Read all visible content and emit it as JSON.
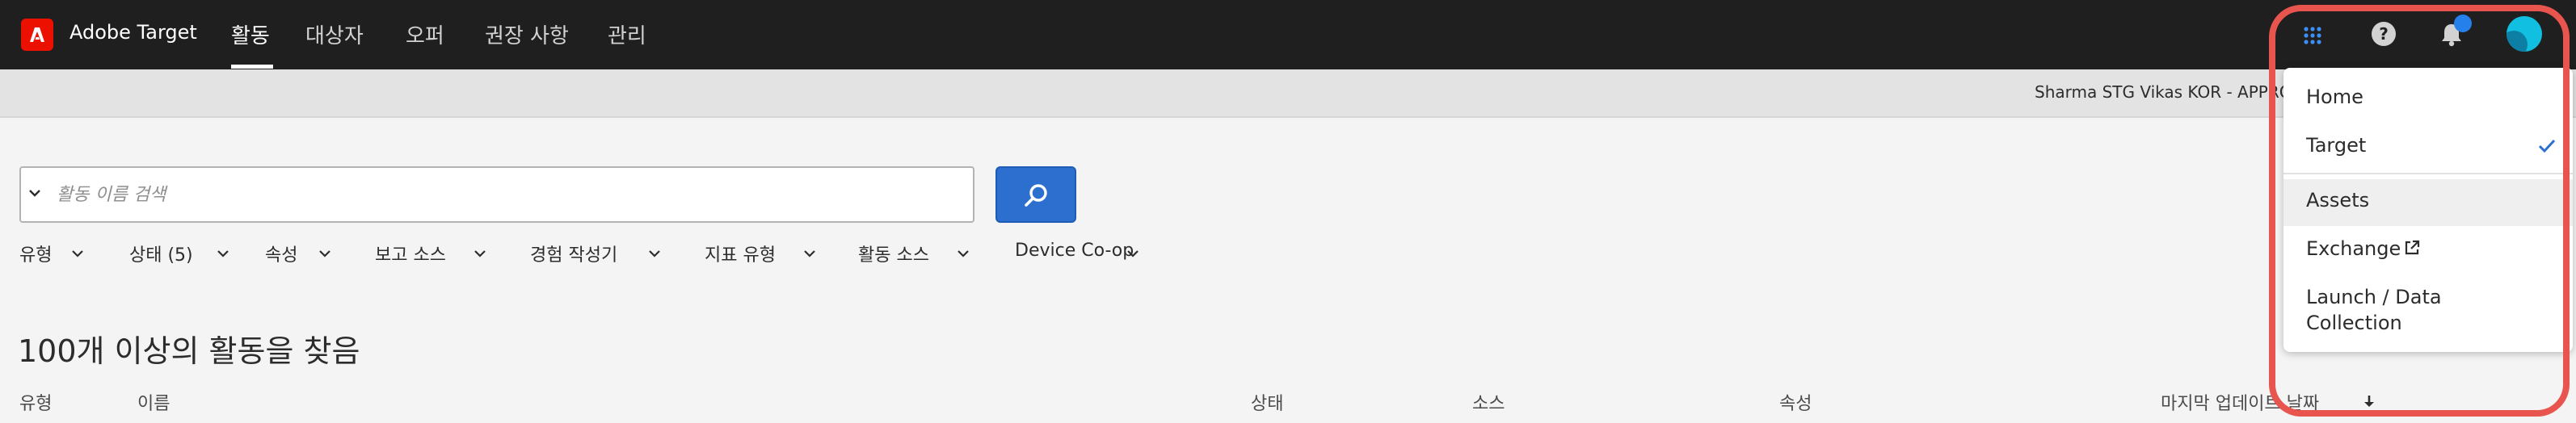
{
  "header": {
    "app_name": "Adobe Target",
    "tabs": [
      {
        "label": "활동"
      },
      {
        "label": "대상자"
      },
      {
        "label": "오퍼"
      },
      {
        "label": "권장 사항"
      },
      {
        "label": "관리"
      }
    ],
    "active_tab": "활동",
    "icons": [
      "app-switcher-icon",
      "help-icon",
      "notification-bell-icon",
      "user-avatar"
    ]
  },
  "workspace": {
    "label": "Sharma STG Vikas KOR - APPRO"
  },
  "search": {
    "placeholder": "활동 이름 검색"
  },
  "filters": [
    {
      "label": "유형"
    },
    {
      "label": "상태 (5)"
    },
    {
      "label": "속성"
    },
    {
      "label": "보고 소스"
    },
    {
      "label": "경험 작성기"
    },
    {
      "label": "지표 유형"
    },
    {
      "label": "활동 소스"
    },
    {
      "label": "Device Co-op"
    }
  ],
  "results": {
    "title": "100개 이상의 활동을 찾음"
  },
  "table": {
    "columns": [
      {
        "label": "유형"
      },
      {
        "label": "이름"
      },
      {
        "label": "상태"
      },
      {
        "label": "소스"
      },
      {
        "label": "속성"
      },
      {
        "label": "마지막 업데이트 날짜"
      }
    ],
    "sort_direction": "descending"
  },
  "app_switcher": {
    "items": [
      {
        "label": "Home"
      },
      {
        "label": "Target",
        "selected": true
      },
      {
        "label": "Assets",
        "hovered": true
      },
      {
        "label": "Exchange",
        "external": true
      },
      {
        "label": "Launch / Data Collection"
      }
    ]
  },
  "colors": {
    "topbar": "#1f1f1f",
    "brand": "#eb1000",
    "accent": "#2d6fce",
    "highlight": "#e8554e"
  }
}
